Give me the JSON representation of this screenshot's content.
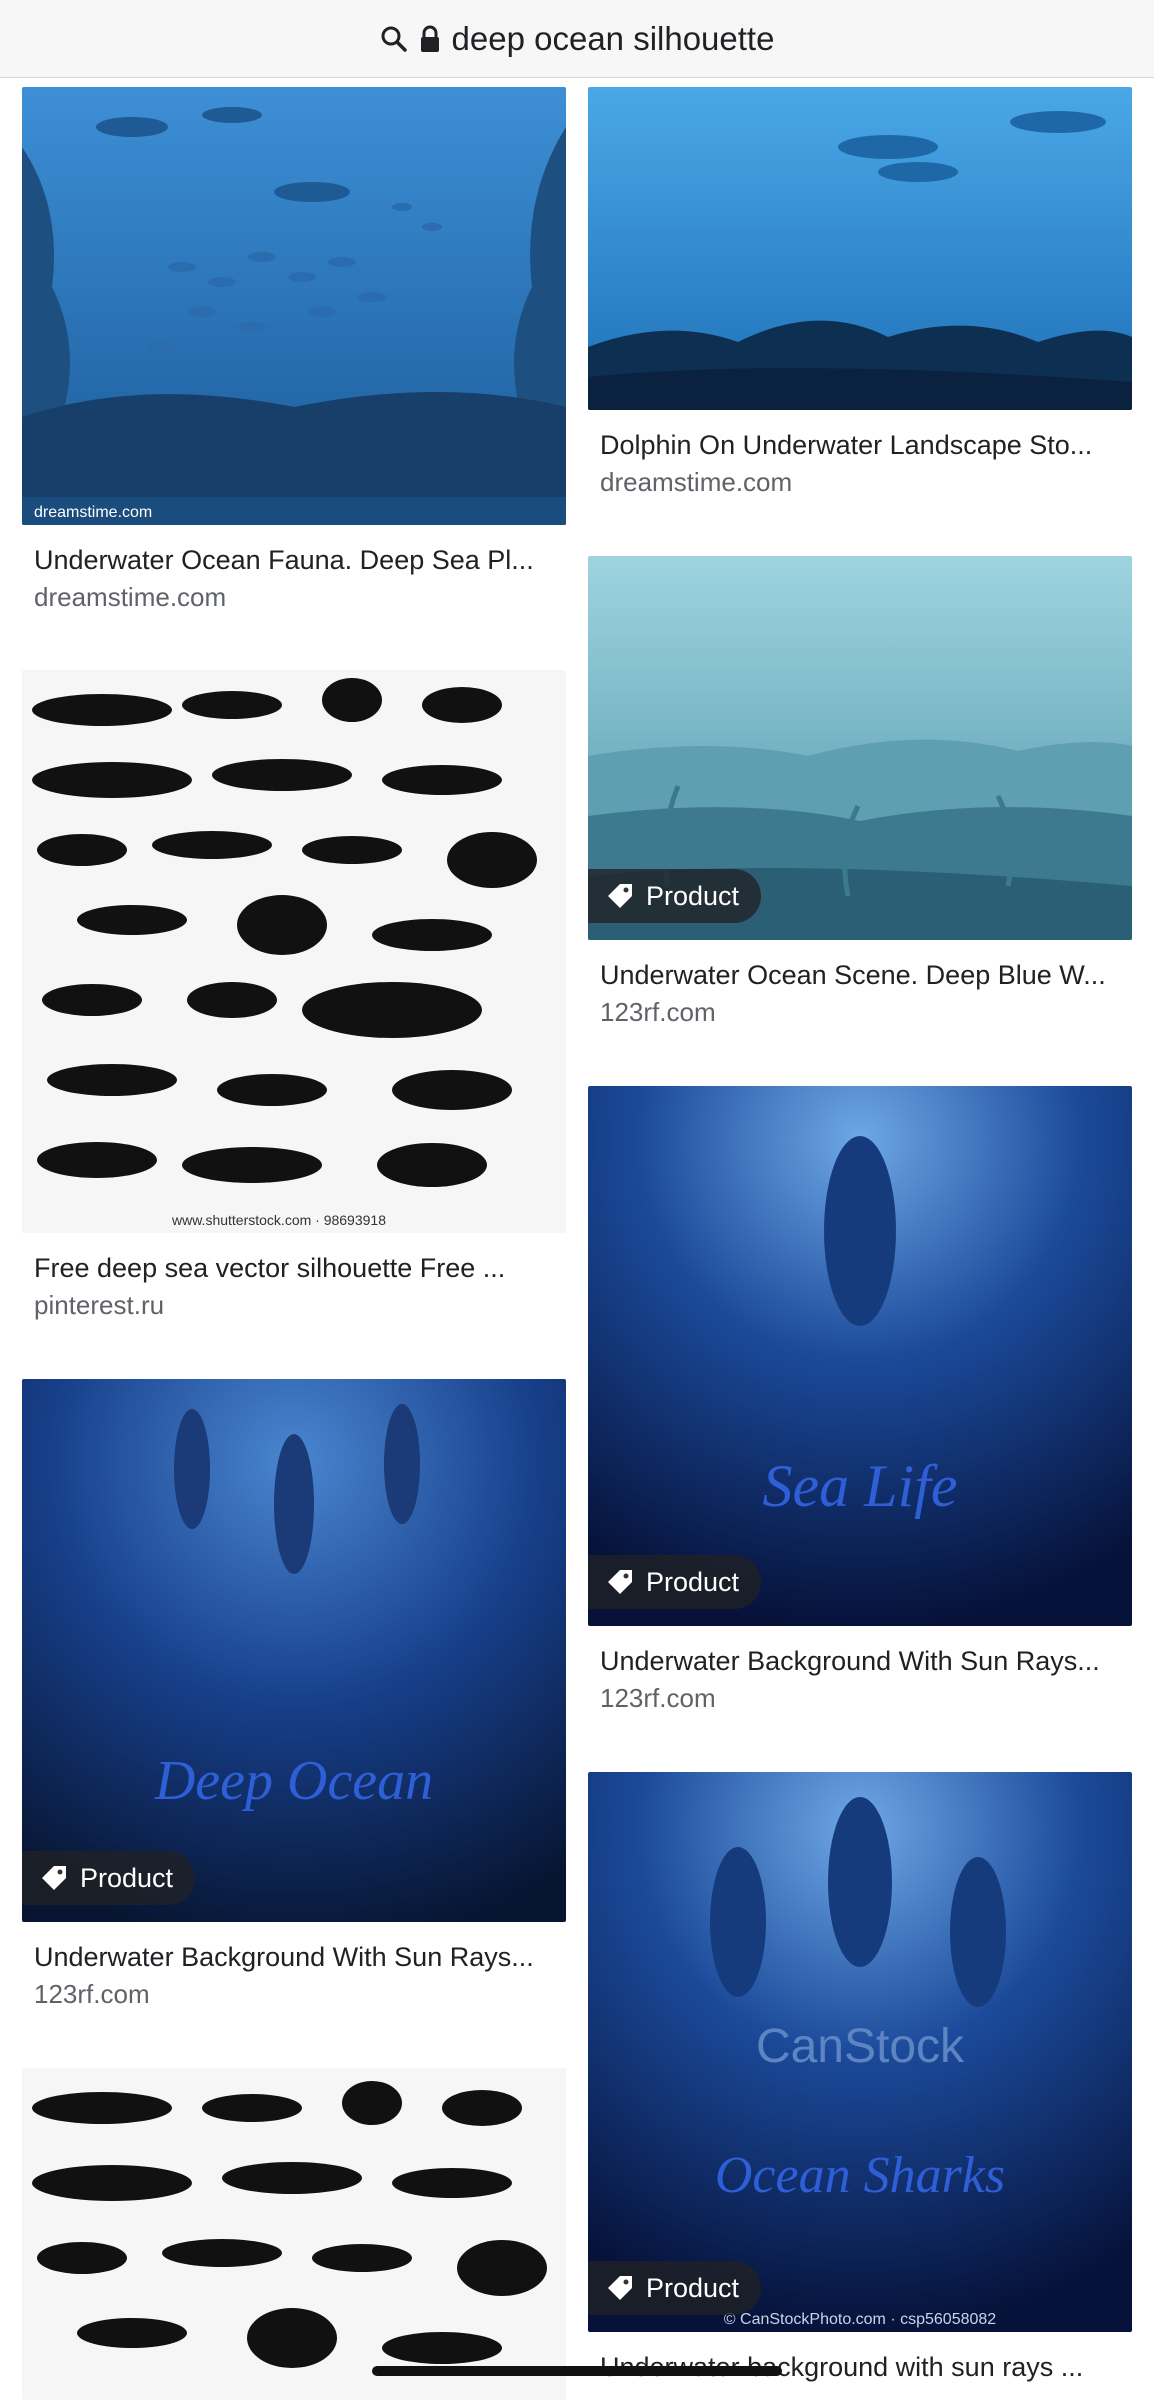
{
  "search": {
    "query": "deep ocean silhouette"
  },
  "results": [
    {
      "title": "Underwater Ocean Fauna. Deep Sea Pl...",
      "source": "dreamstime.com",
      "badge": "",
      "watermark": "dreamstime.com"
    },
    {
      "title": "Free deep sea vector silhouette Free ...",
      "source": "pinterest.ru",
      "badge": "",
      "watermark": "www.shutterstock.com · 98693918"
    },
    {
      "title": "Underwater Background With Sun Rays...",
      "source": "123rf.com",
      "badge": "Product",
      "overlay_text": "Deep Ocean"
    },
    {
      "title": "",
      "source": "",
      "badge": ""
    },
    {
      "title": "Dolphin On Underwater Landscape Sto...",
      "source": "dreamstime.com",
      "badge": ""
    },
    {
      "title": "Underwater Ocean Scene. Deep Blue W...",
      "source": "123rf.com",
      "badge": "Product"
    },
    {
      "title": "Underwater Background With Sun Rays...",
      "source": "123rf.com",
      "badge": "Product",
      "overlay_text": "Sea Life"
    },
    {
      "title": "Underwater background with sun rays ...",
      "source": "",
      "badge": "Product",
      "overlay_text": "Ocean Sharks",
      "watermark": "CanStock",
      "watermark_small": "© CanStockPhoto.com · csp56058082"
    }
  ],
  "colors": {
    "badge_bg": "#202124",
    "title": "#202124",
    "source": "#5f6368"
  }
}
